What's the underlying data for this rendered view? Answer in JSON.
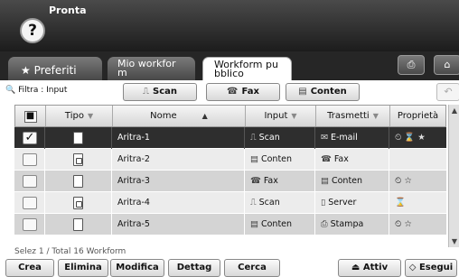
{
  "header": {
    "status": "Pronta",
    "help_icon": "?"
  },
  "tabs": [
    {
      "label": "Preferiti",
      "icon": "★"
    },
    {
      "label": "Mio workfor\nm"
    },
    {
      "label": "Workform pu\nbblico"
    }
  ],
  "top_buttons": {
    "copy_icon": "⎙",
    "home_icon": "⌂"
  },
  "filter": {
    "label": "Filtra : Input",
    "icon": "🔍"
  },
  "filter_buttons": [
    {
      "label": "Scan",
      "icon": "⎍"
    },
    {
      "label": "Fax",
      "icon": "☎"
    },
    {
      "label": "Conten",
      "icon": "▤"
    }
  ],
  "undo_icon": "↶",
  "columns": {
    "select": "■",
    "tipo": "Tipo",
    "nome": "Nome",
    "input": "Input",
    "trasmetti": "Trasmetti",
    "proprieta": "Proprietà"
  },
  "rows": [
    {
      "checked": "✓",
      "nome": "Aritra-1",
      "input": "Scan",
      "input_icon": "⎍",
      "trasmetti": "E-mail",
      "trasmetti_icon": "✉",
      "proprieta": "⏲ ⌛ ★"
    },
    {
      "checked": "",
      "nome": "Aritra-2",
      "input": "Conten",
      "input_icon": "▤",
      "trasmetti": "Fax",
      "trasmetti_icon": "☎",
      "proprieta": ""
    },
    {
      "checked": "",
      "nome": "Aritra-3",
      "input": "Fax",
      "input_icon": "☎",
      "trasmetti": "Conten",
      "trasmetti_icon": "▤",
      "proprieta": "⏲ ☆"
    },
    {
      "checked": "",
      "nome": "Aritra-4",
      "input": "Scan",
      "input_icon": "⎍",
      "trasmetti": "Server",
      "trasmetti_icon": "▯",
      "proprieta": "⌛"
    },
    {
      "checked": "",
      "nome": "Aritra-5",
      "input": "Conten",
      "input_icon": "▤",
      "trasmetti": "Stampa",
      "trasmetti_icon": "⎙",
      "proprieta": "⏲ ☆"
    }
  ],
  "footer": {
    "count": "Selez 1 / Total 16 Workform",
    "buttons": [
      "Crea",
      "Elimina",
      "Modifica",
      "Dettag",
      "Cerca"
    ],
    "attiv": "Attiv",
    "esegui": "Esegui"
  }
}
